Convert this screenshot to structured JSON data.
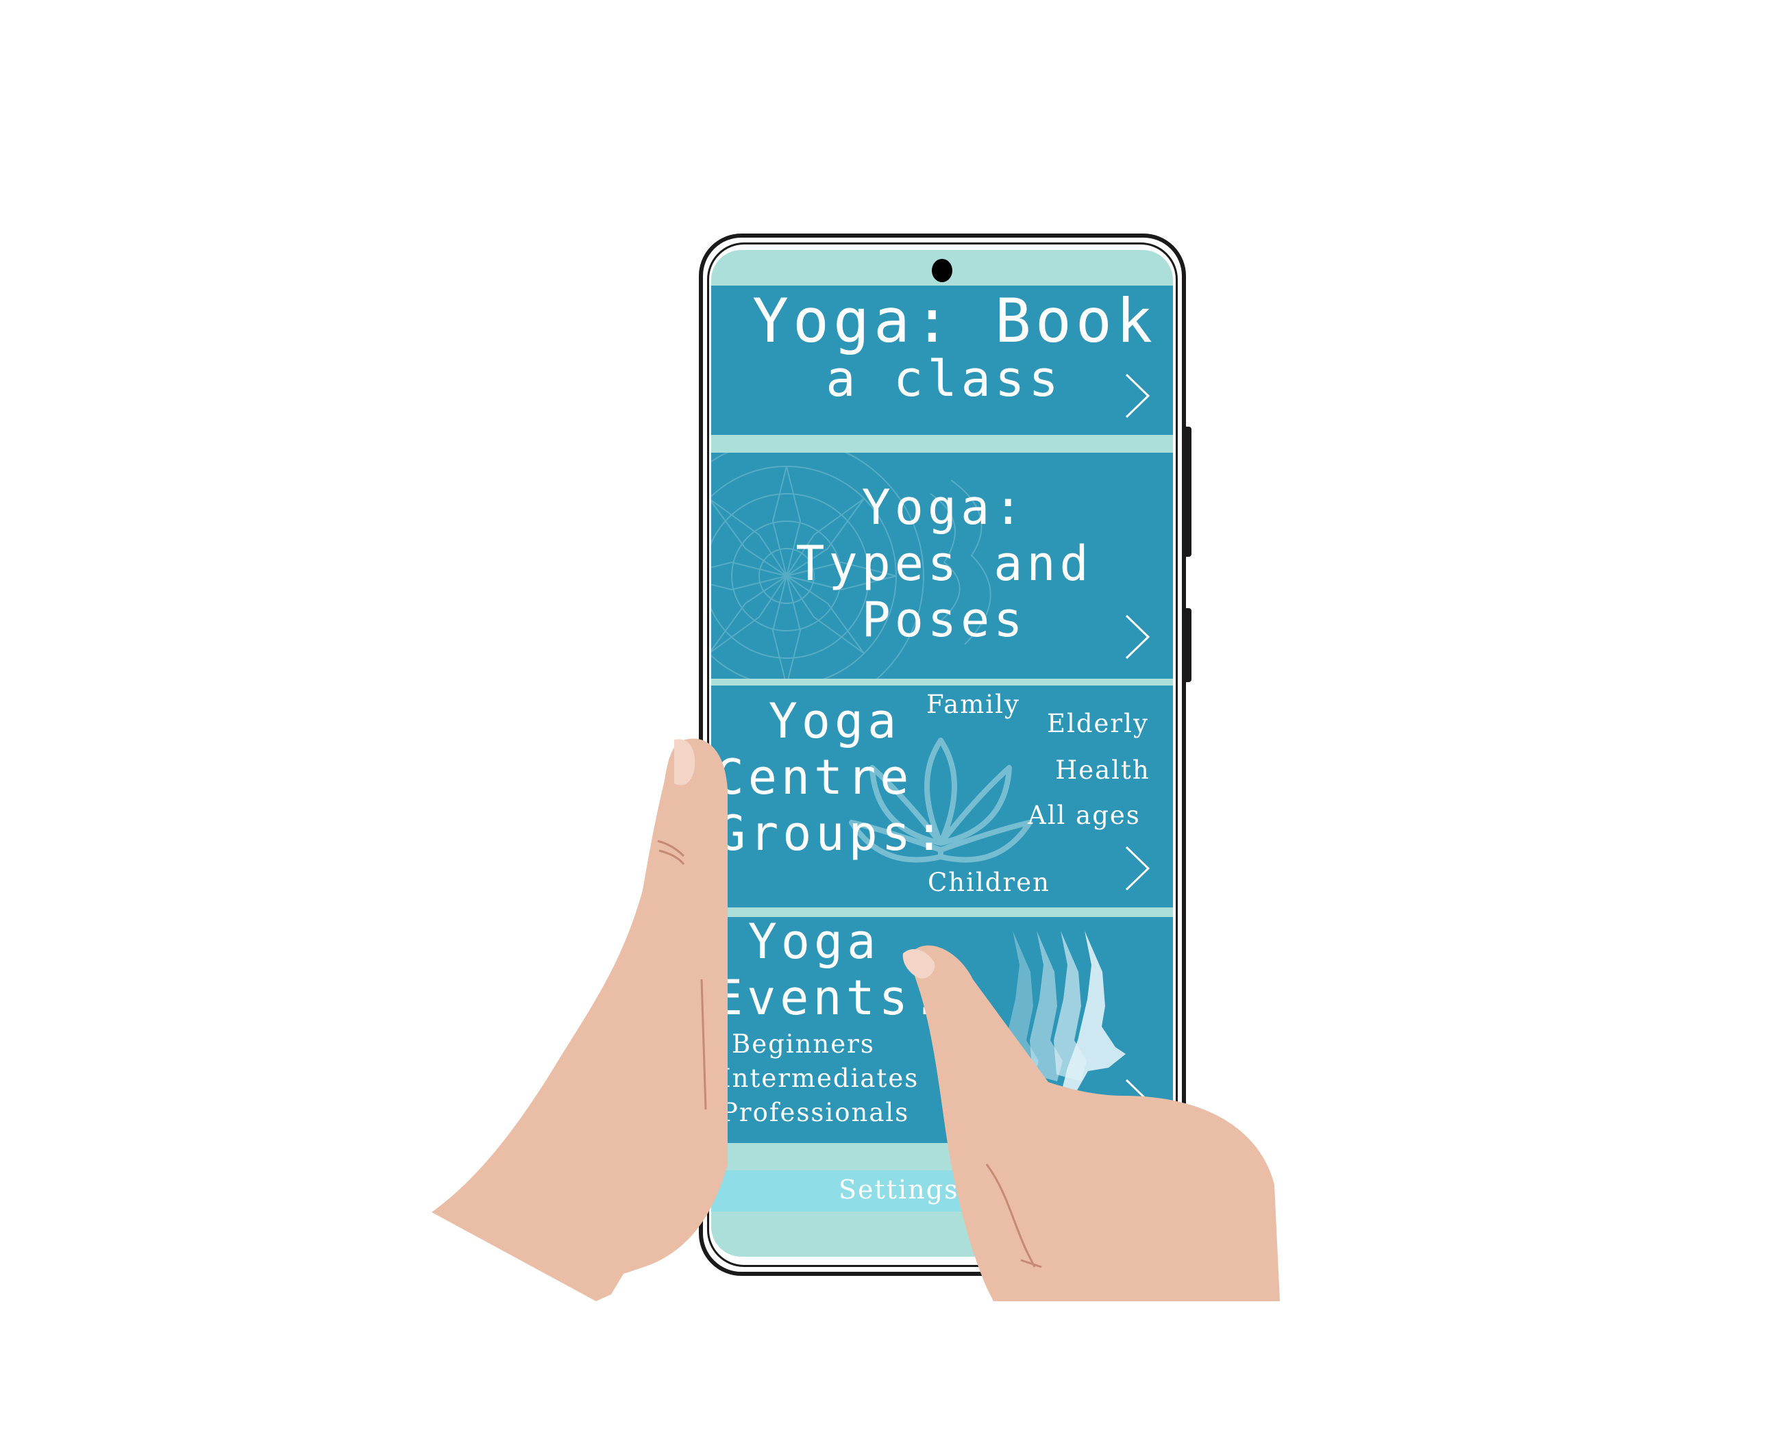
{
  "app": {
    "panels": [
      {
        "title_line1": "Yoga: Book",
        "title_line2": "a class"
      },
      {
        "title_line1": "Yoga:",
        "title_line2": "Types and",
        "title_line3": "Poses"
      },
      {
        "title_line1": "Yoga",
        "title_line2": "Centre",
        "title_line3": "Groups:",
        "tags": [
          "Family",
          "Elderly",
          "Health",
          "All ages",
          "Children"
        ]
      },
      {
        "title_line1": "Yoga",
        "title_line2": "Events:",
        "levels": [
          "Beginners",
          "Intermediates",
          "Professionals"
        ]
      }
    ],
    "settings_label": "Settings"
  },
  "colors": {
    "panel": "#2d95b5",
    "screen_bg": "#acdfd9",
    "settings_bar": "#8fdde6",
    "skin": "#e9bda6"
  },
  "icons": [
    "camera-icon",
    "chevron-right-icon",
    "mandala-icon",
    "lotus-icon",
    "dancer-silhouette-icon"
  ]
}
